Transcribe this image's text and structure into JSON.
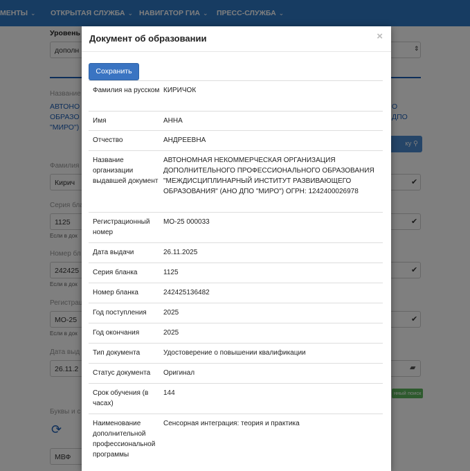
{
  "nav": {
    "items": [
      "МЕНТЫ",
      "ОТКРЫТАЯ СЛУЖБА",
      "НАВИГАТОР ГИА",
      "ПРЕСС-СЛУЖБА"
    ],
    "chevron": "⌄"
  },
  "background": {
    "level_label": "Уровень",
    "level_value": "дополн",
    "org_label": "Название",
    "org_lines": [
      "АВТОНО",
      "ОБРАЗО",
      "\"МИРО\")"
    ],
    "org_right_lines": [
      "О",
      "ДПО"
    ],
    "search_label": "ку",
    "surname_label": "Фамилия",
    "surname_value": "Кирич",
    "series_label": "Серия бла",
    "series_value": "1125",
    "hint_1": "Если в док",
    "number_label": "Номер бл",
    "number_value": "242425",
    "hint_2": "Если в док",
    "reg_label": "Регистрац",
    "reg_value": "МО-25",
    "hint_3": "Если в док",
    "date_label": "Дата выд",
    "date_value": "26.11.2",
    "green_label": "нный поиск",
    "letters_label": "Буквы и с",
    "mvf_value": "МВФ"
  },
  "modal": {
    "title": "Документ об образовании",
    "close": "×",
    "save_label": "Сохранить",
    "rows": [
      {
        "label": "Фамилия на русском",
        "value": "КИРИЧОК"
      },
      {
        "label": "Имя",
        "value": "АННА"
      },
      {
        "label": "Отчество",
        "value": "АНДРЕЕВНА"
      },
      {
        "label": "Название организации выдавшей документ",
        "value": "АВТОНОМНАЯ НЕКОММЕРЧЕСКАЯ ОРГАНИЗАЦИЯ ДОПОЛНИТЕЛЬНОГО ПРОФЕССИОНАЛЬНОГО ОБРАЗОВАНИЯ \"МЕЖДИСЦИПЛИНАРНЫЙ ИНСТИТУТ РАЗВИВАЮЩЕГО ОБРАЗОВАНИЯ\" (АНО ДПО \"МИРО\") ОГРН: 1242400026978"
      },
      {
        "label": "Регистрационный номер",
        "value": "МО-25 000033"
      },
      {
        "label": "Дата выдачи",
        "value": "26.11.2025"
      },
      {
        "label": "Серия бланка",
        "value": "1125"
      },
      {
        "label": "Номер бланка",
        "value": "242425136482"
      },
      {
        "label": "Год поступления",
        "value": "2025"
      },
      {
        "label": "Год окончания",
        "value": "2025"
      },
      {
        "label": "Тип документа",
        "value": "Удостоверение о повышении квалификации"
      },
      {
        "label": "Статус документа",
        "value": "Оригинал"
      },
      {
        "label": "Срок обучения (в часах)",
        "value": "144"
      },
      {
        "label": "Наименование дополнительной профессиональной программы",
        "value": "Сенсорная интеграция: теория и практика"
      }
    ]
  }
}
